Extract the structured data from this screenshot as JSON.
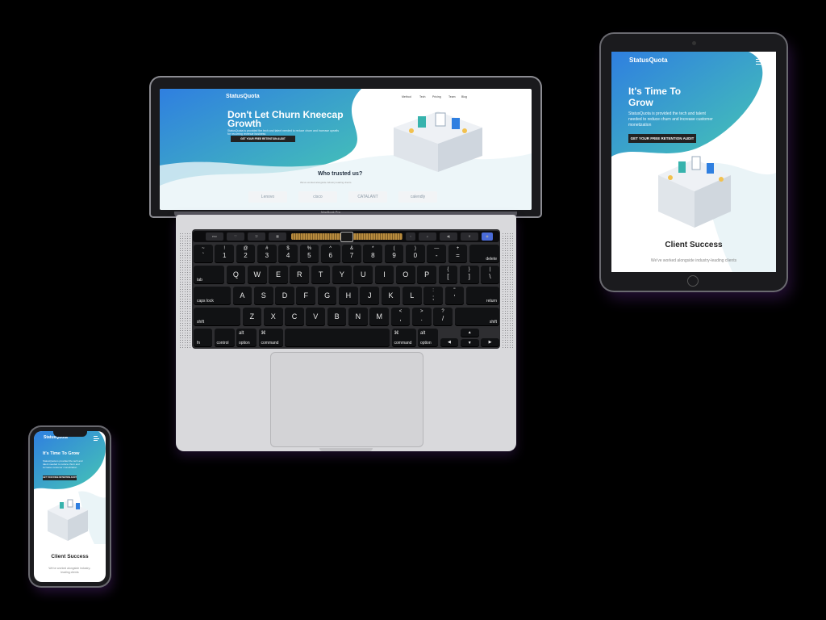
{
  "laptop": {
    "model_label": "MacBook Pro",
    "site": {
      "brand": "StatusQuota",
      "nav": [
        "Method",
        "Tech",
        "Pricing",
        "Team",
        "Blog"
      ],
      "hero_title": "Don't Let Churn Kneecap Growth",
      "hero_subtitle": "StatusQuota is provided the tech and talent needed to reduce churn and increase upsells for recurring revenue business",
      "cta": "GET YOUR FREE RETENTION AUDIT",
      "trusted_heading": "Who trusted us?",
      "trusted_sub": "We've worked alongside industry leading clients",
      "logos": [
        "Lenovo",
        "cisco",
        "CATALANT",
        "calendly"
      ]
    },
    "touchbar": [
      "esc",
      "♡",
      "⎋",
      "▦",
      "‹",
      "☼",
      "◀)",
      "✕",
      "◉"
    ],
    "keyboard": {
      "row1": [
        [
          "~",
          "`"
        ],
        [
          "!",
          "1"
        ],
        [
          "@",
          "2"
        ],
        [
          "#",
          "3"
        ],
        [
          "$",
          "4"
        ],
        [
          "%",
          "5"
        ],
        [
          "^",
          "6"
        ],
        [
          "&",
          "7"
        ],
        [
          "*",
          "8"
        ],
        [
          "(",
          "9"
        ],
        [
          ")",
          "0"
        ],
        [
          "—",
          "-"
        ],
        [
          "+",
          "="
        ]
      ],
      "row1_end": "delete",
      "row2_start": "tab",
      "row2": [
        "Q",
        "W",
        "E",
        "R",
        "T",
        "Y",
        "U",
        "I",
        "O",
        "P"
      ],
      "row2_end": [
        [
          "{",
          "["
        ],
        [
          "}",
          "]"
        ],
        [
          "|",
          "\\"
        ]
      ],
      "row3_start": "caps lock",
      "row3": [
        "A",
        "S",
        "D",
        "F",
        "G",
        "H",
        "J",
        "K",
        "L"
      ],
      "row3_end": [
        [
          ":",
          ";"
        ],
        [
          "\"",
          "'"
        ]
      ],
      "row3_return": "return",
      "row4_shift_left": "shift",
      "row4": [
        "Z",
        "X",
        "C",
        "V",
        "B",
        "N",
        "M"
      ],
      "row4_end": [
        [
          "<",
          ","
        ],
        [
          ">",
          "."
        ],
        [
          "?",
          "/"
        ]
      ],
      "row4_shift_right": "shift",
      "row5": {
        "fn": "fn",
        "control": "control",
        "option_left": "option",
        "option_left_top": "alt",
        "command_left": "command",
        "command_left_top": "⌘",
        "command_right": "command",
        "command_right_top": "⌘",
        "option_right": "option",
        "option_right_top": "alt",
        "arrows": [
          "◀",
          "▲",
          "▼",
          "▶"
        ]
      }
    }
  },
  "tablet": {
    "brand": "StatusQuota",
    "hero_title": "It's Time To Grow",
    "hero_subtitle": "StatusQuota is provided the tech and talent needed to reduce churn and increase customer monetization",
    "cta": "GET YOUR FREE RETENTION AUDIT",
    "section_title": "Client Success",
    "section_sub": "We've worked alongside industry-leading clients"
  },
  "phone": {
    "brand": "StatusQuota",
    "hero_title": "It's Time To Grow",
    "hero_subtitle": "StatusQuota is provided the tech and talent needed to reduce churn and increase customer monetization",
    "cta": "GET YOUR FREE RETENTION AUDIT",
    "section_title": "Client Success",
    "section_sub": "We've worked alongside industry-leading clients"
  },
  "colors": {
    "gradient_start": "#2f7fe0",
    "gradient_end": "#46c6b4",
    "background": "#000000",
    "dark_cta": "#222222"
  }
}
